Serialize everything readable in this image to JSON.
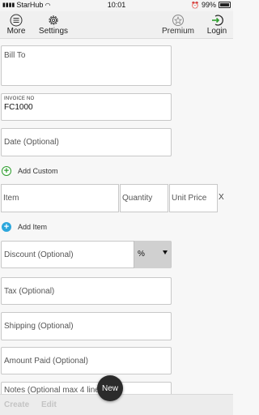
{
  "status_bar": {
    "carrier": "StarHub",
    "time": "10:01",
    "battery": "99%"
  },
  "toolbar": {
    "more_label": "More",
    "settings_label": "Settings",
    "premium_label": "Premium",
    "login_label": "Login"
  },
  "form": {
    "bill_to_placeholder": "Bill To",
    "invoice_no_label": "INVOICE NO",
    "invoice_no_value": "FC1000",
    "date_placeholder": "Date (Optional)",
    "add_custom_label": "Add Custom",
    "item": {
      "item_placeholder": "Item",
      "quantity_placeholder": "Quantity",
      "unit_price_placeholder": "Unit Price",
      "remove_label": "X"
    },
    "add_item_label": "Add Item",
    "discount_placeholder": "Discount (Optional)",
    "discount_type": "%",
    "tax_placeholder": "Tax (Optional)",
    "shipping_placeholder": "Shipping (Optional)",
    "amount_paid_placeholder": "Amount Paid (Optional)",
    "notes_placeholder": "Notes (Optional max 4 lines)"
  },
  "bottom_bar": {
    "create_label": "Create",
    "edit_label": "Edit",
    "new_label": "New"
  },
  "colors": {
    "add_custom_icon": "#2e9d2e",
    "add_item_icon": "#2da7dc",
    "fab": "#2b2b2b"
  }
}
